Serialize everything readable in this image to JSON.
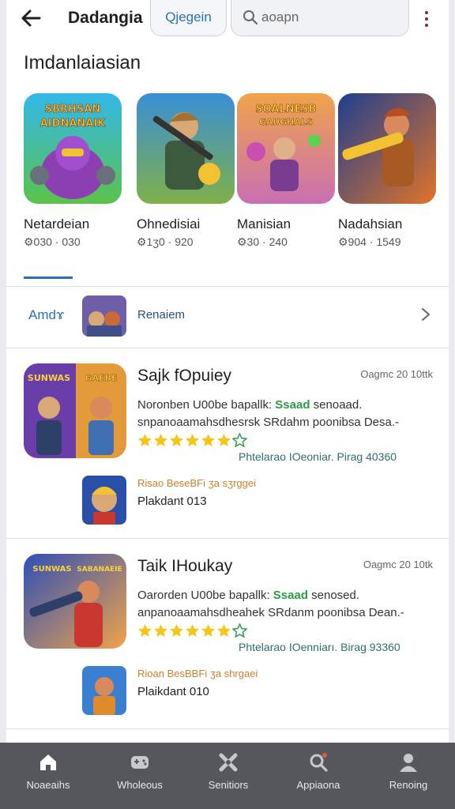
{
  "header": {
    "title": "Dadangia",
    "tab_label": "Qjegein",
    "search_placeholder": "aoapn"
  },
  "section": {
    "title": "Imdanlaiasian"
  },
  "carousel": [
    {
      "art": "SBRHSAN\nAIDNANAIK",
      "name": "Netardeian",
      "meta": "⚙030 · 030"
    },
    {
      "art": "",
      "name": "Ohnedisiai",
      "meta": "⚙1ʒ0 · 920"
    },
    {
      "art": "SOALNESB\nGAUGHALS",
      "name": "Manisian",
      "meta": "⚙30 · 240"
    },
    {
      "art": "",
      "name": "Nadahsian",
      "meta": "⚙904 · 1549"
    }
  ],
  "strip": {
    "label": "Amdɤ",
    "text": "Renaiem"
  },
  "list": [
    {
      "art_left": "SUNWAS",
      "art_right": "GAEBE",
      "title": "Sajk fOpuiey",
      "date": "Oagmc 20 10ttk",
      "desc_a": "Noronben U00be bapallk: ",
      "desc_hl": "Ssaad",
      "desc_b": " senoaad. snpanoaamahsdhesrsk SRdahm poonibsa Desa.-",
      "rating": 6,
      "tag": "Phtelarao IOeoniar.  Pirag 40360",
      "sub_tag": "Risao BeseBFi   ʒa sʒrggei",
      "sub_text": "Plakdant 013"
    },
    {
      "art_left": "SUNWAS",
      "art_right": "SABANAEIE",
      "title": "Taik IHoukay",
      "date": "Oagmc 20 10tk",
      "desc_a": "Oarorden U00be bapallk: ",
      "desc_hl": "Ssaad",
      "desc_b": " senosed. anpanoaamahsdheahek SRdanm poonibsa Dean.-",
      "rating": 6,
      "tag": "Phtelarao IOenniarı.  Birag 93360",
      "sub_tag": "Rioan BesBBFi   ʒa shrgaei",
      "sub_text": "Plaikdant 010"
    }
  ],
  "nav": [
    {
      "label": "Noaeaihs",
      "icon": "home-icon"
    },
    {
      "label": "Wholeous",
      "icon": "gamepad-icon"
    },
    {
      "label": "Senitiors",
      "icon": "tools-icon"
    },
    {
      "label": "Appiaona",
      "icon": "search-icon"
    },
    {
      "label": "Renoing",
      "icon": "profile-icon"
    }
  ],
  "colors": {
    "accent": "#2a6fb5",
    "star": "#f5c518",
    "highlight": "#2f9a45",
    "nav_bg": "#55575c"
  }
}
